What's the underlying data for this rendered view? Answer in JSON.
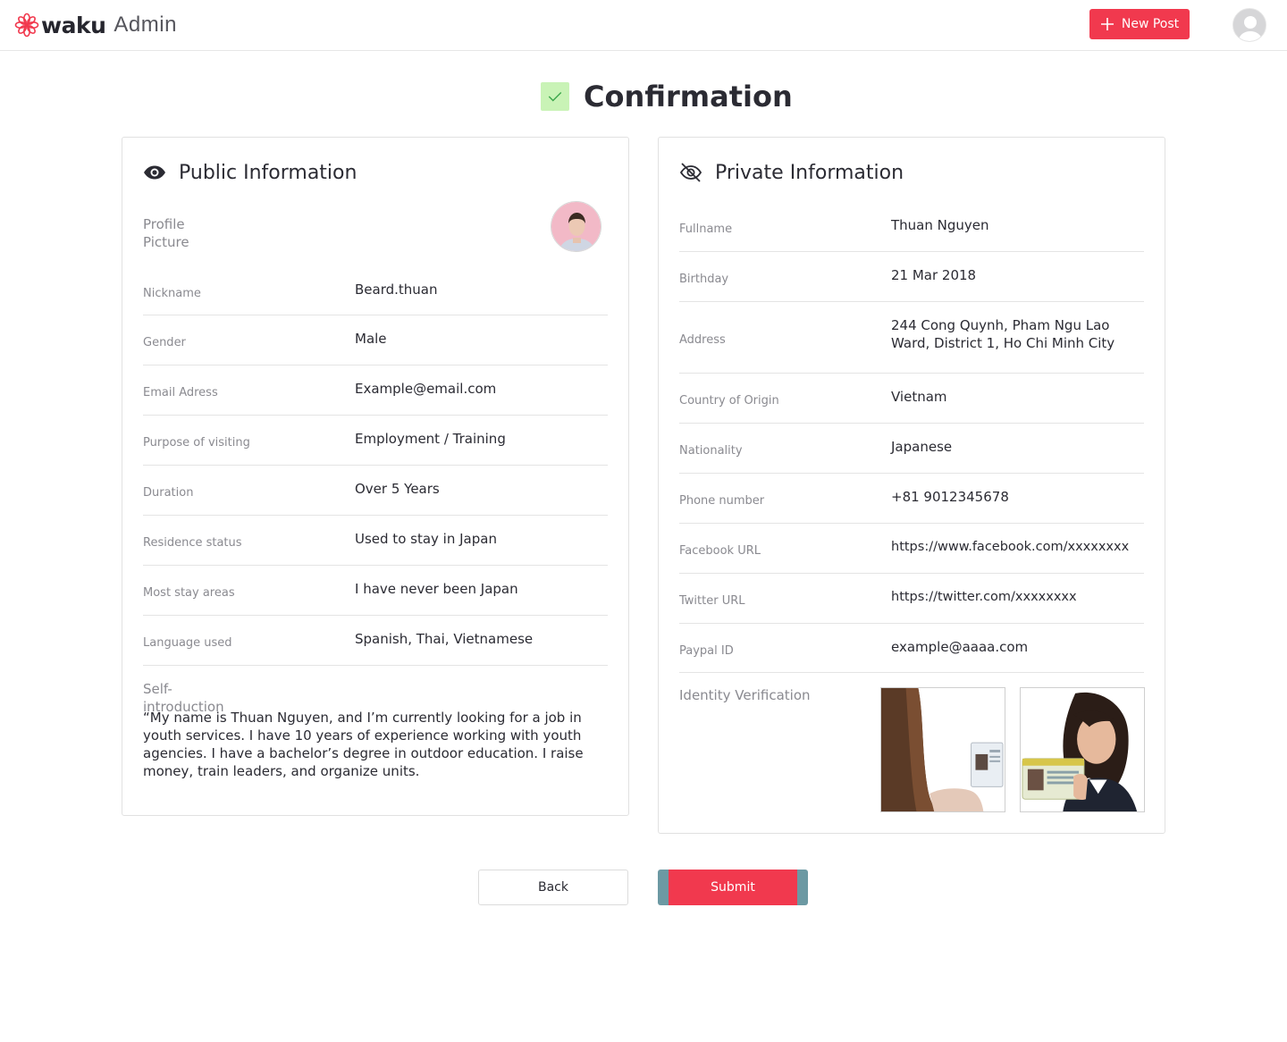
{
  "header": {
    "brand": "waku",
    "brand_sub": "Admin",
    "new_post_label": "New Post"
  },
  "page": {
    "title": "Confirmation"
  },
  "public": {
    "title": "Public Information",
    "profile_label": "Profile Picture",
    "rows": [
      {
        "label": "Nickname",
        "value": "Beard.thuan"
      },
      {
        "label": "Gender",
        "value": "Male"
      },
      {
        "label": "Email Adress",
        "value": "Example@email.com"
      },
      {
        "label": "Purpose of visiting",
        "value": "Employment / Training"
      },
      {
        "label": "Duration",
        "value": "Over 5 Years"
      },
      {
        "label": "Residence status",
        "value": "Used to stay in Japan"
      },
      {
        "label": "Most stay areas",
        "value": "I have never been Japan"
      },
      {
        "label": "Language used",
        "value": "Spanish, Thai, Vietnamese"
      }
    ],
    "self_intro_label": "Self-introduction",
    "self_intro_text": "“My name is Thuan Nguyen, and I’m currently looking for a job in youth services. I have 10 years of experience working with youth agencies. I have a bachelor’s degree in outdoor education. I raise money, train leaders, and organize units."
  },
  "private": {
    "title": "Private Information",
    "rows": [
      {
        "label": "Fullname",
        "value": "Thuan Nguyen"
      },
      {
        "label": "Birthday",
        "value": "21 Mar 2018"
      },
      {
        "label": "Address",
        "value": "244 Cong Quynh, Pham Ngu Lao Ward, District 1, Ho Chi Minh City"
      },
      {
        "label": "Country of Origin",
        "value": "Vietnam"
      },
      {
        "label": "Nationality",
        "value": "Japanese"
      },
      {
        "label": "Phone number",
        "value": "+81 9012345678"
      },
      {
        "label": "Facebook URL",
        "value": "https://www.facebook.com/xxxxxxxx"
      },
      {
        "label": "Twitter URL",
        "value": "https://twitter.com/xxxxxxxx"
      },
      {
        "label": "Paypal ID",
        "value": "example@aaaa.com"
      }
    ],
    "id_label": "Identity Verification"
  },
  "actions": {
    "back_label": "Back",
    "submit_label": "Submit"
  },
  "colors": {
    "accent": "#f1394e",
    "check_bg": "#c9f3b6",
    "check_mark": "#3aa64a"
  }
}
